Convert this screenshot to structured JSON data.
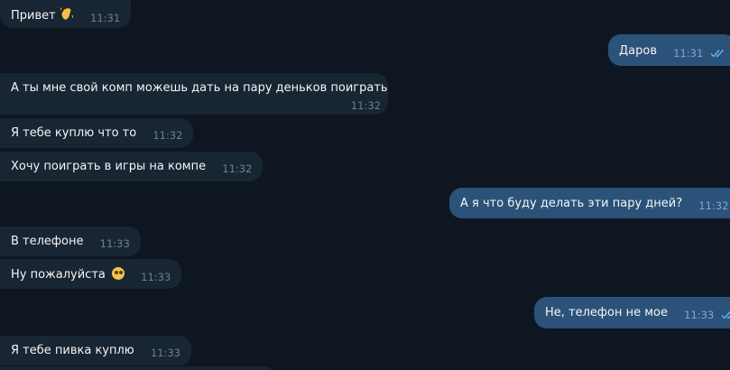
{
  "messages": [
    {
      "id": "m1",
      "side": "in",
      "text": "Привет",
      "emoji": "wave-icon",
      "time": "11:31"
    },
    {
      "id": "m2",
      "side": "out",
      "text": "Даров",
      "time": "11:31",
      "read": true
    },
    {
      "id": "m3",
      "side": "in",
      "text": "А ты мне свой комп можешь дать на пару деньков поиграть",
      "time": "11:32"
    },
    {
      "id": "m4",
      "side": "in",
      "text": "Я тебе куплю что то",
      "time": "11:32"
    },
    {
      "id": "m5",
      "side": "in",
      "text": "Хочу поиграть в игры на компе",
      "time": "11:32"
    },
    {
      "id": "m6",
      "side": "out",
      "text": "А я что буду делать эти пару дней?",
      "time": "11:32",
      "read": true
    },
    {
      "id": "m7",
      "side": "in",
      "text": "В телефоне",
      "time": "11:33"
    },
    {
      "id": "m8",
      "side": "in",
      "text": "Ну пожалуйста",
      "emoji": "pleading-face-icon",
      "time": "11:33"
    },
    {
      "id": "m9",
      "side": "out",
      "text": "Не, телефон не мое",
      "time": "11:33",
      "read": true
    },
    {
      "id": "m10",
      "side": "in",
      "text": "Я тебе пивка куплю",
      "time": "11:33"
    }
  ],
  "colors": {
    "background": "#0e1621",
    "incoming_bubble": "#182533",
    "outgoing_bubble": "#2b5278",
    "read_ticks": "#6ab2f2"
  }
}
